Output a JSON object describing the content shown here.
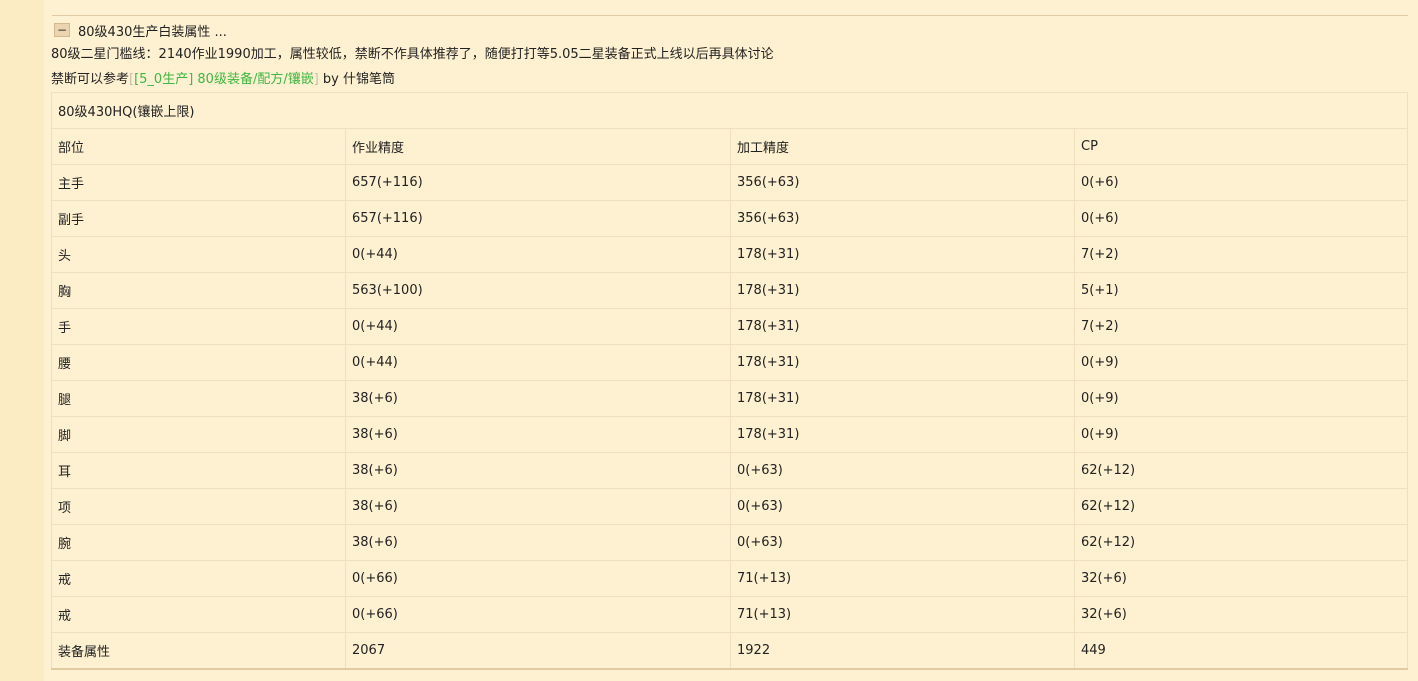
{
  "collapse": {
    "icon": "−",
    "title": "80级430生产白装属性 ..."
  },
  "note": {
    "line1": "80级二星门槛线：2140作业1990加工，属性较低，禁断不作具体推荐了，随便打打等5.05二星装备正式上线以后再具体讨论",
    "line2_prefix": "禁断可以参考",
    "link_open": "[",
    "link_text": "[5_0生产] 80级装备/配方/镶嵌",
    "link_close": "]",
    "line2_suffix": " by 什锦笔筒"
  },
  "table": {
    "caption": "80级430HQ(镶嵌上限)",
    "headers": [
      "部位",
      "作业精度",
      "加工精度",
      "CP"
    ],
    "rows": [
      [
        "主手",
        "657(+116)",
        "356(+63)",
        "0(+6)"
      ],
      [
        "副手",
        "657(+116)",
        "356(+63)",
        "0(+6)"
      ],
      [
        "头",
        "0(+44)",
        "178(+31)",
        "7(+2)"
      ],
      [
        "胸",
        "563(+100)",
        "178(+31)",
        "5(+1)"
      ],
      [
        "手",
        "0(+44)",
        "178(+31)",
        "7(+2)"
      ],
      [
        "腰",
        "0(+44)",
        "178(+31)",
        "0(+9)"
      ],
      [
        "腿",
        "38(+6)",
        "178(+31)",
        "0(+9)"
      ],
      [
        "脚",
        "38(+6)",
        "178(+31)",
        "0(+9)"
      ],
      [
        "耳",
        "38(+6)",
        "0(+63)",
        "62(+12)"
      ],
      [
        "项",
        "38(+6)",
        "0(+63)",
        "62(+12)"
      ],
      [
        "腕",
        "38(+6)",
        "0(+63)",
        "62(+12)"
      ],
      [
        "戒",
        "0(+66)",
        "71(+13)",
        "32(+6)"
      ],
      [
        "戒",
        "0(+66)",
        "71(+13)",
        "32(+6)"
      ]
    ],
    "total": [
      "装备属性",
      "2067",
      "1922",
      "449"
    ]
  },
  "colors": {
    "background": "#fef1d1",
    "link": "#3fb63f",
    "border": "#eee0bd"
  }
}
